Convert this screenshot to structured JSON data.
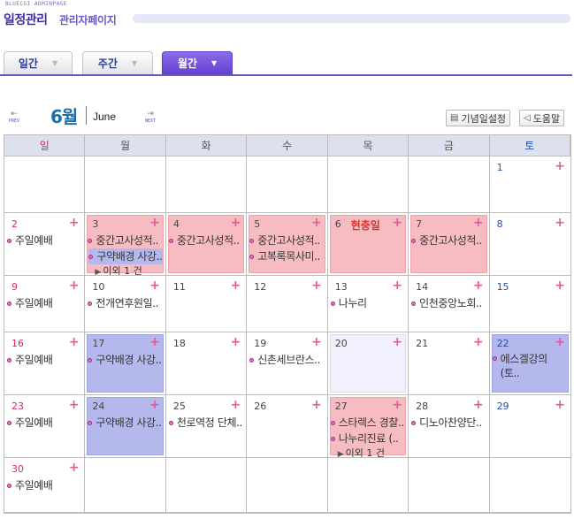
{
  "header": {
    "brand_small": "BLUECGI ADMINPAGE",
    "title": "일정관리",
    "subtitle": "관리자페이지"
  },
  "tabs": [
    {
      "label": "일간",
      "active": false
    },
    {
      "label": "주간",
      "active": false
    },
    {
      "label": "월간",
      "active": true
    }
  ],
  "nav": {
    "prev_label": "PREV",
    "next_label": "NEXT",
    "month_kr": "6월",
    "month_en": "June",
    "anniversary_button": "기념일설정",
    "help_button": "도움말"
  },
  "weekdays": [
    "일",
    "월",
    "화",
    "수",
    "목",
    "금",
    "토"
  ],
  "colors": {
    "accent": "#6240d2",
    "sunday": "#e0226e",
    "saturday": "#1c4fb5",
    "pink_event": "#f7bcc1",
    "blue_event": "#b5b8ec",
    "holiday": "#d8342c"
  },
  "weeks": [
    [
      {
        "day": null
      },
      {
        "day": null
      },
      {
        "day": null
      },
      {
        "day": null
      },
      {
        "day": null
      },
      {
        "day": null
      },
      {
        "day": "1",
        "events": []
      }
    ],
    [
      {
        "day": "2",
        "events": [
          {
            "text": "주일예배"
          }
        ]
      },
      {
        "day": "3",
        "style": "pink",
        "events": [
          {
            "text": "중간고사성적.."
          },
          {
            "text": "구약배경 사강..",
            "highlight": true
          }
        ],
        "more": "이외 1 건"
      },
      {
        "day": "4",
        "style": "pink",
        "events": [
          {
            "text": "중간고사성적.."
          }
        ]
      },
      {
        "day": "5",
        "style": "pink",
        "events": [
          {
            "text": "중간고사성적.."
          },
          {
            "text": "고복록목사미.."
          }
        ]
      },
      {
        "day": "6",
        "style": "pink",
        "holiday": "현충일",
        "events": []
      },
      {
        "day": "7",
        "style": "pink",
        "events": [
          {
            "text": "중간고사성적.."
          }
        ]
      },
      {
        "day": "8",
        "events": []
      }
    ],
    [
      {
        "day": "9",
        "events": [
          {
            "text": "주일예배"
          }
        ]
      },
      {
        "day": "10",
        "events": [
          {
            "text": "전개연후원일.."
          }
        ]
      },
      {
        "day": "11",
        "events": []
      },
      {
        "day": "12",
        "events": []
      },
      {
        "day": "13",
        "events": [
          {
            "text": "나누리"
          }
        ]
      },
      {
        "day": "14",
        "events": [
          {
            "text": "인천중앙노회.."
          }
        ]
      },
      {
        "day": "15",
        "events": []
      }
    ],
    [
      {
        "day": "16",
        "events": [
          {
            "text": "주일예배"
          }
        ]
      },
      {
        "day": "17",
        "style": "blue",
        "events": [
          {
            "text": "구약배경 사강.."
          }
        ]
      },
      {
        "day": "18",
        "events": []
      },
      {
        "day": "19",
        "events": [
          {
            "text": "신촌세브란스.."
          }
        ]
      },
      {
        "day": "20",
        "style": "lightblue",
        "events": []
      },
      {
        "day": "21",
        "events": []
      },
      {
        "day": "22",
        "style": "sat-blue",
        "events": [
          {
            "text": "에스겔강의 (토..",
            "wrap": true
          }
        ]
      }
    ],
    [
      {
        "day": "23",
        "events": [
          {
            "text": "주일예배"
          }
        ]
      },
      {
        "day": "24",
        "style": "blue",
        "events": [
          {
            "text": "구약배경 사강.."
          }
        ]
      },
      {
        "day": "25",
        "events": [
          {
            "text": "천로역정 단체.."
          }
        ]
      },
      {
        "day": "26",
        "events": []
      },
      {
        "day": "27",
        "style": "pink",
        "events": [
          {
            "text": "스타렉스 경찰.."
          },
          {
            "text": "나누리진료 (.."
          }
        ],
        "more": "이외 1 건"
      },
      {
        "day": "28",
        "events": [
          {
            "text": "디노아찬양단.."
          }
        ]
      },
      {
        "day": "29",
        "events": []
      }
    ],
    [
      {
        "day": "30",
        "events": [
          {
            "text": "주일예배"
          }
        ]
      },
      {
        "day": null
      },
      {
        "day": null
      },
      {
        "day": null
      },
      {
        "day": null
      },
      {
        "day": null
      },
      {
        "day": null
      }
    ]
  ]
}
